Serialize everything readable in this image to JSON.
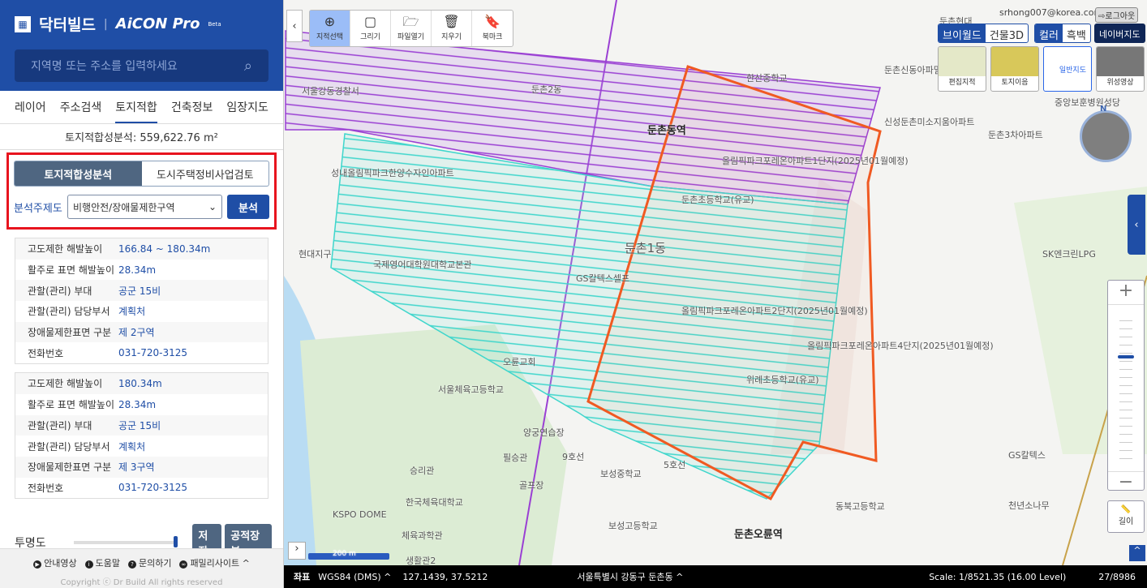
{
  "brand": {
    "name": "닥터빌드",
    "product": "AiCON Pro",
    "tag": "Beta"
  },
  "search": {
    "placeholder": "지역명 또는 주소를 입력하세요"
  },
  "tabs": [
    "레이어",
    "주소검색",
    "토지적합",
    "건축정보",
    "임장지도"
  ],
  "area_text": "토지적합성분석: 559,622.76 m²",
  "analysis": {
    "seg": [
      "토지적합성분석",
      "도시주택정비사업검토"
    ],
    "label": "분석주제도",
    "select": "비행안전/장애물제한구역",
    "button": "분석"
  },
  "info_tables": [
    [
      {
        "k": "고도제한 해발높이",
        "v": "166.84 ~ 180.34m"
      },
      {
        "k": "활주로 표면 해발높이",
        "v": "28.34m"
      },
      {
        "k": "관할(관리) 부대",
        "v": "공군 15비"
      },
      {
        "k": "관할(관리) 담당부서",
        "v": "계획처"
      },
      {
        "k": "장애물제한표면 구분",
        "v": "제 2구역"
      },
      {
        "k": "전화번호",
        "v": "031-720-3125"
      }
    ],
    [
      {
        "k": "고도제한 해발높이",
        "v": "180.34m"
      },
      {
        "k": "활주로 표면 해발높이",
        "v": "28.34m"
      },
      {
        "k": "관할(관리) 부대",
        "v": "공군 15비"
      },
      {
        "k": "관할(관리) 담당부서",
        "v": "계획처"
      },
      {
        "k": "장애물제한표면 구분",
        "v": "제 3구역"
      },
      {
        "k": "전화번호",
        "v": "031-720-3125"
      }
    ]
  ],
  "opacity": {
    "label": "투명도",
    "value": 1.0
  },
  "buttons": {
    "save": "저장",
    "cadastral": "공적장부"
  },
  "footer": {
    "links": [
      "안내영상",
      "도움말",
      "문의하기",
      "패밀리사이트"
    ],
    "copyright": "Copyright ⓒ Dr Build All rights reserved"
  },
  "toolbar": [
    "지적선택",
    "그리기",
    "파일열기",
    "지우기",
    "북마크"
  ],
  "user": {
    "email": "srhong007@korea.com",
    "logout": "로그아웃"
  },
  "view_mode": [
    "브이월드",
    "건물3D"
  ],
  "color_mode": [
    "컬러",
    "흑백"
  ],
  "naver": "네이버지도",
  "basemaps": [
    "편집지적",
    "토지이음",
    "일반지도",
    "위성영상"
  ],
  "selected_basemap": "일반지도",
  "measure": "길이",
  "scalebar": "200 m",
  "map_labels": [
    "둔촌현대",
    "둔촌신동아파밀리에아파트",
    "한산중학교",
    "둔촌동역",
    "신성둔촌미소지움아파트",
    "둔촌3차아파트",
    "중앙보훈병원성당",
    "올림픽파크포레온아파트1단지(2025년01월예정)",
    "둔촌초등학교(유교)",
    "둔촌1동",
    "성내올림픽파크한양수자인아파트",
    "현대지구",
    "국제영어대학원대학교본관",
    "GS칼텍스셀프",
    "올림픽파크포레온아파트2단지(2025년01월예정)",
    "올림픽파크포레온아파트4단지(2025년01월예정)",
    "위례초등학교(유교)",
    "오륜교회",
    "서울체육고등학교",
    "양궁연습장",
    "필승관",
    "승리관",
    "한국체육대학교",
    "골프장",
    "보성중학교",
    "보성고등학교",
    "동북고등학교",
    "둔촌오륜역",
    "KSPO DOME",
    "체육과학관",
    "생활관2",
    "SK엔크린LPG",
    "GS칼텍스",
    "천년소나무",
    "서울강동경찰서",
    "둔촌2동",
    "9호선",
    "5호선"
  ],
  "status": {
    "coord_label": "좌표",
    "crs": "WGS84 (DMS)",
    "coord": "127.1439, 37.5212",
    "address": "서울특별시 강동구 둔촌동",
    "scale": "Scale: 1/8521.35 (16.00 Level)",
    "count": "27/8986"
  }
}
